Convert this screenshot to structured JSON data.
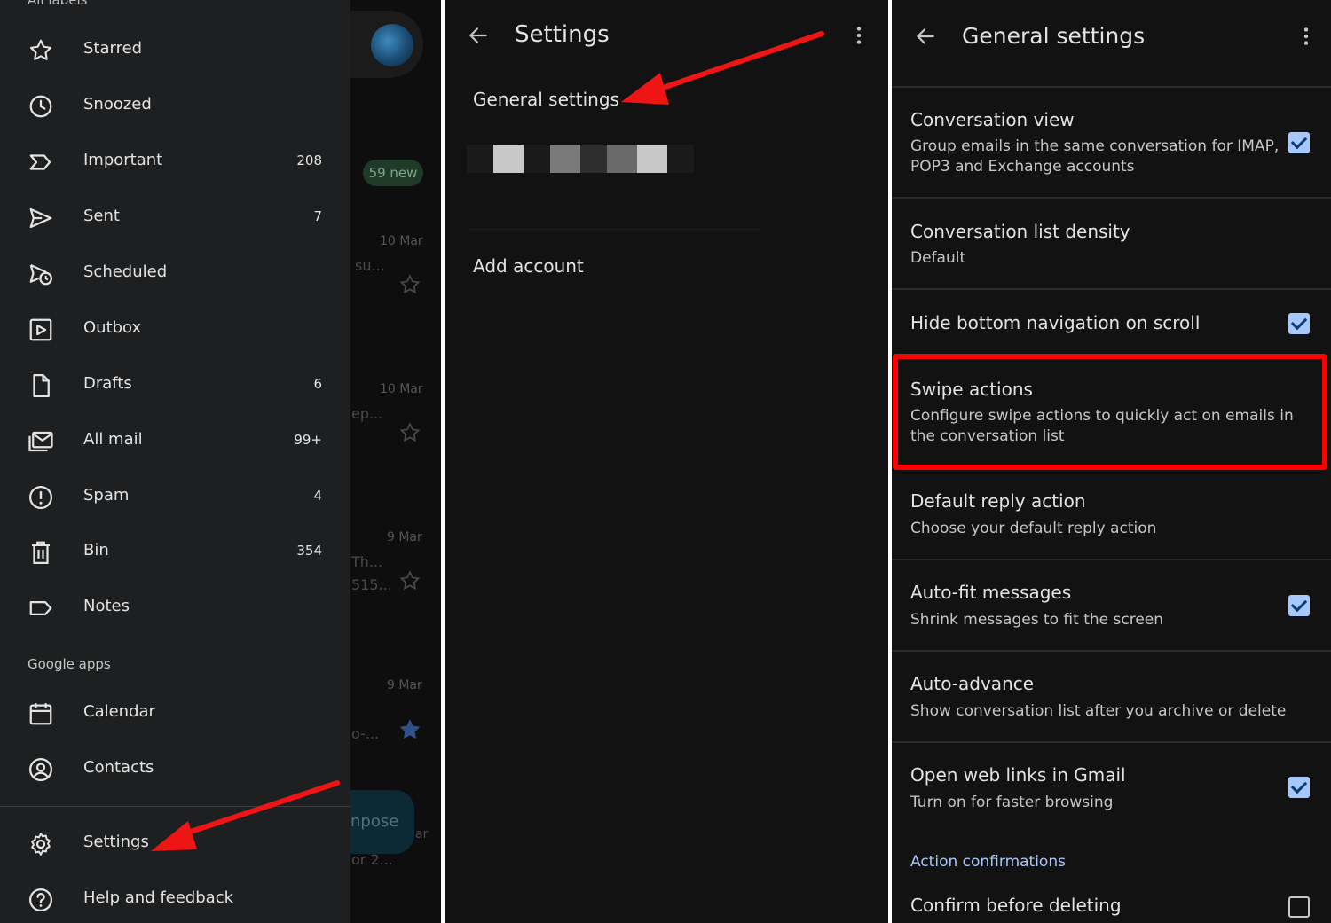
{
  "panel1": {
    "drawer_top_label": "All labels",
    "new_badge": "59 new",
    "items": [
      {
        "label": "Starred",
        "count": "",
        "icon": "star-icon"
      },
      {
        "label": "Snoozed",
        "count": "",
        "icon": "clock-icon"
      },
      {
        "label": "Important",
        "count": "208",
        "icon": "important-icon"
      },
      {
        "label": "Sent",
        "count": "7",
        "icon": "send-icon"
      },
      {
        "label": "Scheduled",
        "count": "",
        "icon": "scheduled-icon"
      },
      {
        "label": "Outbox",
        "count": "",
        "icon": "outbox-icon"
      },
      {
        "label": "Drafts",
        "count": "6",
        "icon": "draft-icon"
      },
      {
        "label": "All mail",
        "count": "99+",
        "icon": "all-mail-icon"
      },
      {
        "label": "Spam",
        "count": "4",
        "icon": "spam-icon"
      },
      {
        "label": "Bin",
        "count": "354",
        "icon": "bin-icon"
      },
      {
        "label": "Notes",
        "count": "",
        "icon": "label-icon"
      }
    ],
    "google_apps_label": "Google apps",
    "apps": [
      {
        "label": "Calendar",
        "icon": "calendar-icon"
      },
      {
        "label": "Contacts",
        "icon": "contacts-icon"
      }
    ],
    "bottom": [
      {
        "label": "Settings",
        "icon": "gear-icon"
      },
      {
        "label": "Help and feedback",
        "icon": "help-icon"
      }
    ],
    "background": {
      "dates": [
        "10 Mar",
        "10 Mar",
        "9 Mar",
        "9 Mar"
      ],
      "snippets": [
        "su...",
        "ep...",
        "Th...",
        "515...",
        "o-..."
      ],
      "compose_label": "npose",
      "bottom_snips": [
        "ar",
        "or 2..."
      ]
    }
  },
  "panel2": {
    "title": "Settings",
    "general_settings": "General settings",
    "add_account": "Add account"
  },
  "panel3": {
    "title": "General settings",
    "settings": [
      {
        "title": "Conversation view",
        "subtitle": "Group emails in the same conversation for IMAP, POP3 and Exchange accounts",
        "checkbox": "checked"
      },
      {
        "title": "Conversation list density",
        "subtitle": "Default",
        "checkbox": "none"
      },
      {
        "title": "Hide bottom navigation on scroll",
        "subtitle": "",
        "checkbox": "checked"
      },
      {
        "title": "Swipe actions",
        "subtitle": "Configure swipe actions to quickly act on emails in the conversation list",
        "checkbox": "none"
      },
      {
        "title": "Default reply action",
        "subtitle": "Choose your default reply action",
        "checkbox": "none"
      },
      {
        "title": "Auto-fit messages",
        "subtitle": "Shrink messages to fit the screen",
        "checkbox": "checked"
      },
      {
        "title": "Auto-advance",
        "subtitle": "Show conversation list after you archive or delete",
        "checkbox": "none"
      },
      {
        "title": "Open web links in Gmail",
        "subtitle": "Turn on for faster browsing",
        "checkbox": "checked"
      }
    ],
    "section_label": "Action confirmations",
    "confirm_delete": {
      "title": "Confirm before deleting",
      "checkbox": "unchecked"
    }
  },
  "colors": {
    "background": "#121212",
    "drawer": "#1e1f20",
    "checkbox_accent": "#a8c7fa",
    "annotation_red": "#ff0000"
  }
}
